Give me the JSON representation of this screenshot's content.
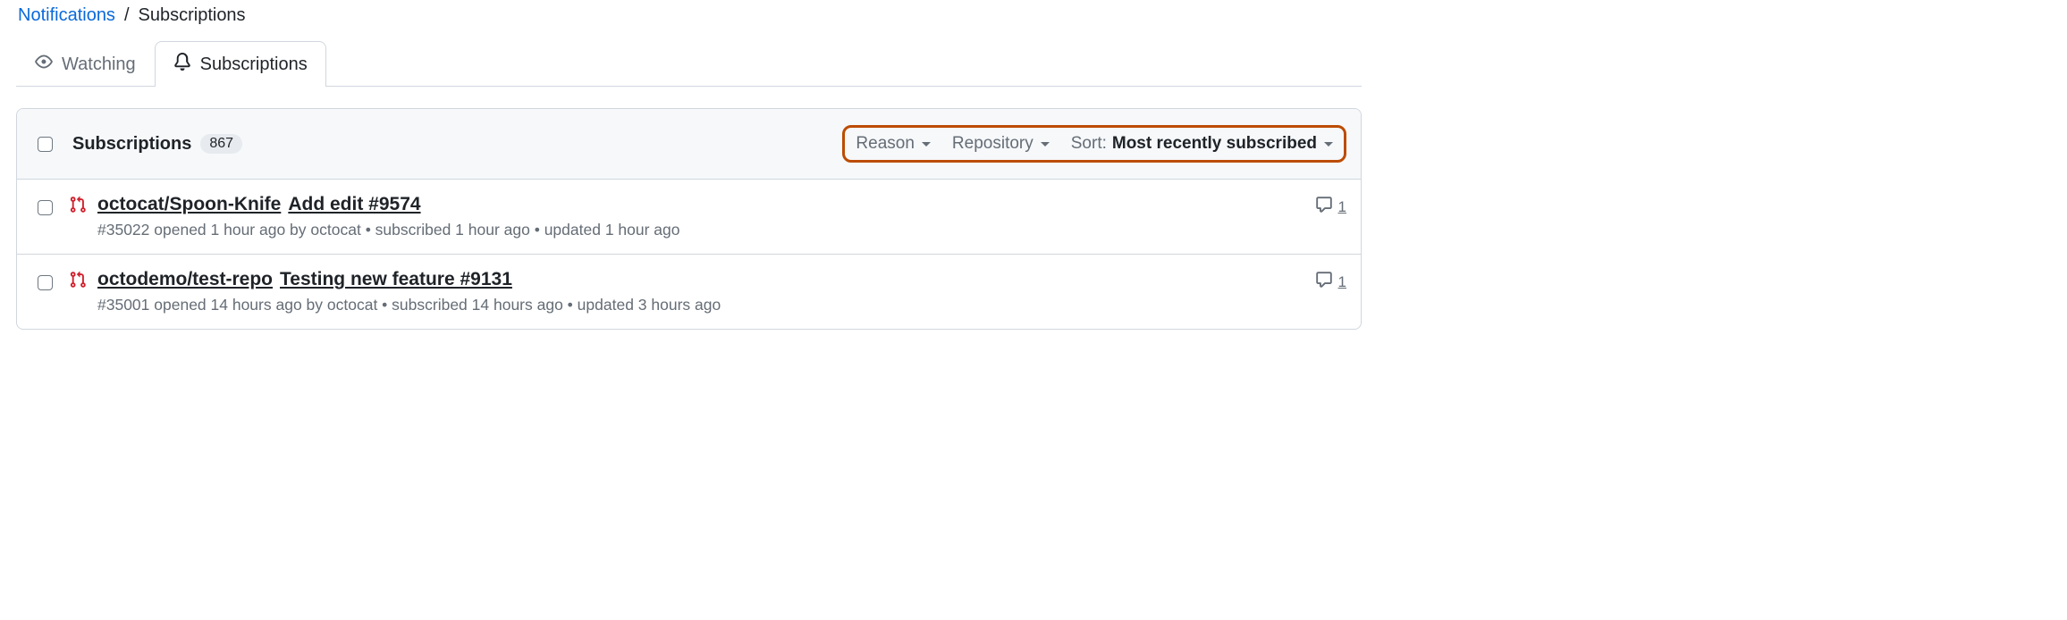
{
  "breadcrumb": {
    "parent": "Notifications",
    "separator": "/",
    "current": "Subscriptions"
  },
  "tabs": {
    "watching": "Watching",
    "subscriptions": "Subscriptions"
  },
  "header": {
    "title": "Subscriptions",
    "count": "867"
  },
  "filters": {
    "reason_label": "Reason",
    "repository_label": "Repository",
    "sort_prefix": "Sort:",
    "sort_value": "Most recently subscribed"
  },
  "rows": [
    {
      "repo": "octocat/Spoon-Knife",
      "title": "Add edit #9574",
      "meta": "#35022 opened 1 hour ago by octocat • subscribed 1 hour ago • updated 1 hour ago",
      "comments": "1"
    },
    {
      "repo": "octodemo/test-repo",
      "title": "Testing new feature #9131",
      "meta": "#35001 opened 14 hours ago by octocat • subscribed 14 hours ago • updated 3 hours ago",
      "comments": "1"
    }
  ]
}
